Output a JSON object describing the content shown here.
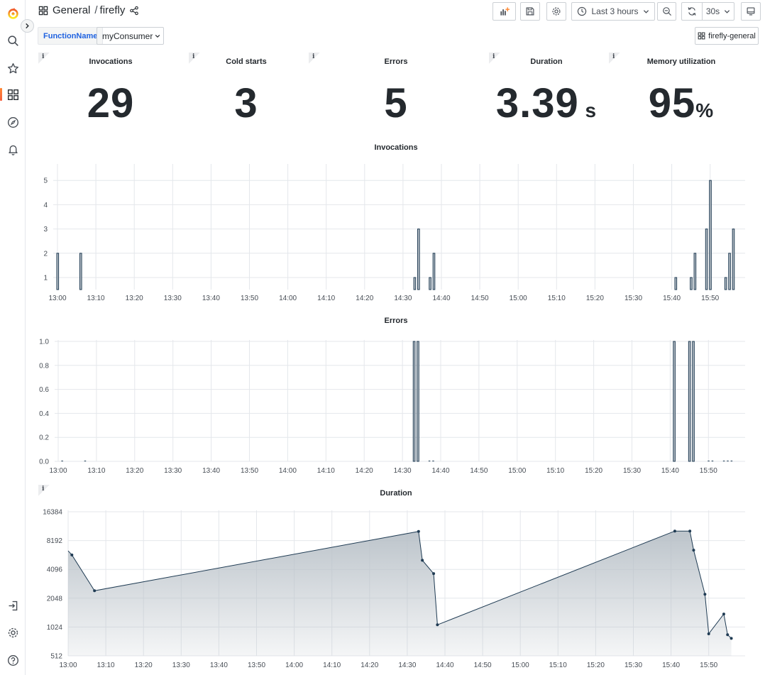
{
  "breadcrumb": {
    "folder": "General",
    "separator": "/",
    "dashboard": "firefly"
  },
  "toolbar": {
    "time_range": "Last 3 hours",
    "refresh_interval": "30s"
  },
  "variables": {
    "label": "FunctionName",
    "value": "myConsumer"
  },
  "dashboard_link": "firefly-general",
  "stats": [
    {
      "title": "Invocations",
      "value": "29",
      "unit": ""
    },
    {
      "title": "Cold starts",
      "value": "3",
      "unit": ""
    },
    {
      "title": "Errors",
      "value": "5",
      "unit": ""
    },
    {
      "title": "Duration",
      "value": "3.39",
      "unit": " s"
    },
    {
      "title": "Memory utilization",
      "value": "95",
      "unit": "%"
    }
  ],
  "info_glyph": "i",
  "colors": {
    "series_stroke": "#1f3b53",
    "series_fill": "#b9c1c8",
    "grid": "#e4e7eb",
    "accent": "#f55f3e",
    "link": "#1f62e0"
  },
  "sidebar": [
    "grafana-logo-icon",
    "search-icon",
    "star-icon",
    "dashboards-icon",
    "explore-icon",
    "alerting-icon",
    "sign-in-icon",
    "settings-icon",
    "help-icon"
  ],
  "chart_data": [
    {
      "type": "bar",
      "title": "Invocations",
      "x_ticks": [
        "13:00",
        "13:10",
        "13:20",
        "13:30",
        "13:40",
        "13:50",
        "14:00",
        "14:10",
        "14:20",
        "14:30",
        "14:40",
        "14:50",
        "15:00",
        "15:10",
        "15:20",
        "15:30",
        "15:40",
        "15:50"
      ],
      "y_ticks": [
        "1",
        "2",
        "3",
        "4",
        "5"
      ],
      "ylim": [
        0.5,
        5.5
      ],
      "points": [
        {
          "t": "13:00",
          "v": 2
        },
        {
          "t": "13:06",
          "v": 2
        },
        {
          "t": "14:33",
          "v": 1
        },
        {
          "t": "14:34",
          "v": 3
        },
        {
          "t": "14:37",
          "v": 1
        },
        {
          "t": "14:38",
          "v": 2
        },
        {
          "t": "15:41",
          "v": 1
        },
        {
          "t": "15:45",
          "v": 1
        },
        {
          "t": "15:46",
          "v": 2
        },
        {
          "t": "15:49",
          "v": 3
        },
        {
          "t": "15:50",
          "v": 5
        },
        {
          "t": "15:54",
          "v": 1
        },
        {
          "t": "15:55",
          "v": 2
        },
        {
          "t": "15:56",
          "v": 3
        }
      ]
    },
    {
      "type": "bar",
      "title": "Errors",
      "x_ticks": [
        "13:00",
        "13:10",
        "13:20",
        "13:30",
        "13:40",
        "13:50",
        "14:00",
        "14:10",
        "14:20",
        "14:30",
        "14:40",
        "14:50",
        "15:00",
        "15:10",
        "15:20",
        "15:30",
        "15:40",
        "15:50"
      ],
      "y_ticks": [
        "0.0",
        "0.2",
        "0.4",
        "0.6",
        "0.8",
        "1.0"
      ],
      "ylim": [
        0,
        1
      ],
      "points": [
        {
          "t": "13:01",
          "v": 0
        },
        {
          "t": "13:07",
          "v": 0
        },
        {
          "t": "14:33",
          "v": 1
        },
        {
          "t": "14:34",
          "v": 1
        },
        {
          "t": "14:37",
          "v": 0
        },
        {
          "t": "14:38",
          "v": 0
        },
        {
          "t": "15:41",
          "v": 1
        },
        {
          "t": "15:45",
          "v": 1
        },
        {
          "t": "15:46",
          "v": 1
        },
        {
          "t": "15:50",
          "v": 0
        },
        {
          "t": "15:51",
          "v": 0
        },
        {
          "t": "15:54",
          "v": 0
        },
        {
          "t": "15:55",
          "v": 0
        },
        {
          "t": "15:56",
          "v": 0
        }
      ]
    },
    {
      "type": "area",
      "title": "Duration",
      "log_scale": 2,
      "x_ticks": [
        "13:00",
        "13:10",
        "13:20",
        "13:30",
        "13:40",
        "13:50",
        "14:00",
        "14:10",
        "14:20",
        "14:30",
        "14:40",
        "14:50",
        "15:00",
        "15:10",
        "15:20",
        "15:30",
        "15:40",
        "15:50"
      ],
      "y_ticks": [
        "512",
        "1024",
        "2048",
        "4096",
        "8192",
        "16384"
      ],
      "ylim": [
        512,
        16384
      ],
      "points": [
        {
          "t": "13:00",
          "v": 6400
        },
        {
          "t": "13:01",
          "v": 5800
        },
        {
          "t": "13:07",
          "v": 2450
        },
        {
          "t": "14:33",
          "v": 10200
        },
        {
          "t": "14:34",
          "v": 5100
        },
        {
          "t": "14:37",
          "v": 3700
        },
        {
          "t": "14:38",
          "v": 1080
        },
        {
          "t": "15:41",
          "v": 10300
        },
        {
          "t": "15:45",
          "v": 10300
        },
        {
          "t": "15:46",
          "v": 6500
        },
        {
          "t": "15:49",
          "v": 2250
        },
        {
          "t": "15:50",
          "v": 870
        },
        {
          "t": "15:54",
          "v": 1400
        },
        {
          "t": "15:55",
          "v": 850
        },
        {
          "t": "15:56",
          "v": 780
        }
      ]
    }
  ]
}
